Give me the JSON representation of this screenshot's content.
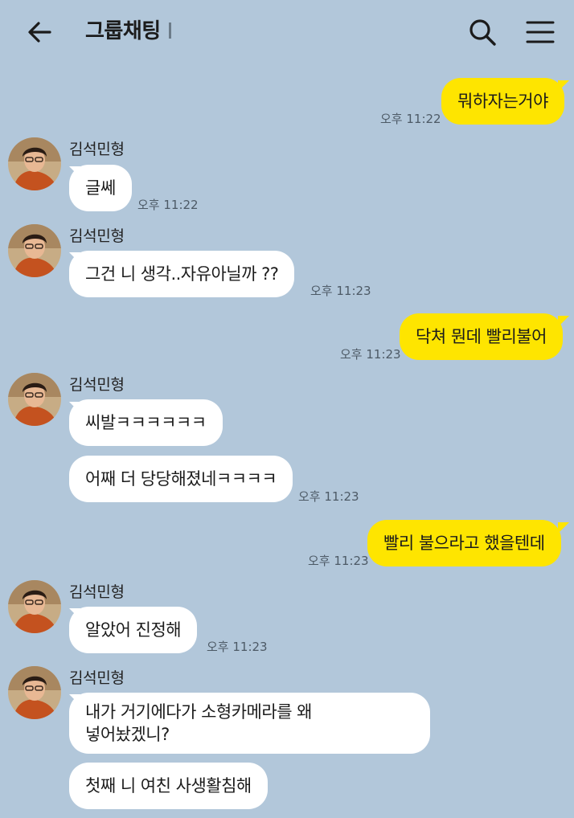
{
  "header": {
    "title": "그룹채팅",
    "back_icon": "arrow-left-icon",
    "search_icon": "search-icon",
    "menu_icon": "hamburger-menu-icon"
  },
  "colors": {
    "background": "#b2c7da",
    "my_bubble": "#fee500",
    "other_bubble": "#ffffff"
  },
  "messages": [
    {
      "from": "me",
      "text": "뭐하자는거야",
      "time": "오후 11:22"
    },
    {
      "from": "김석민형",
      "text": "글쎄",
      "time": "오후 11:22"
    },
    {
      "from": "김석민형",
      "text": "그건 니 생각..자유아닐까 ??",
      "time": "오후 11:23"
    },
    {
      "from": "me",
      "text": "닥쳐 뭔데 빨리불어",
      "time": "오후 11:23"
    },
    {
      "from": "김석민형",
      "text": "씨발ㅋㅋㅋㅋㅋㅋ",
      "time": ""
    },
    {
      "from": "김석민형",
      "text": "어째 더 당당해졌네ㅋㅋㅋㅋ",
      "time": "오후 11:23"
    },
    {
      "from": "me",
      "text": "빨리 불으라고 했을텐데",
      "time": "오후 11:23"
    },
    {
      "from": "김석민형",
      "text": "알았어 진정해",
      "time": "오후 11:23"
    },
    {
      "from": "김석민형",
      "text_line1": "내가 거기에다가 소형카메라를 왜",
      "text_line2": "넣어놨겠니?",
      "time": ""
    },
    {
      "from": "김석민형",
      "text": "첫째 니 여친 사생활침해",
      "time": ""
    }
  ],
  "sender_name": "김석민형"
}
